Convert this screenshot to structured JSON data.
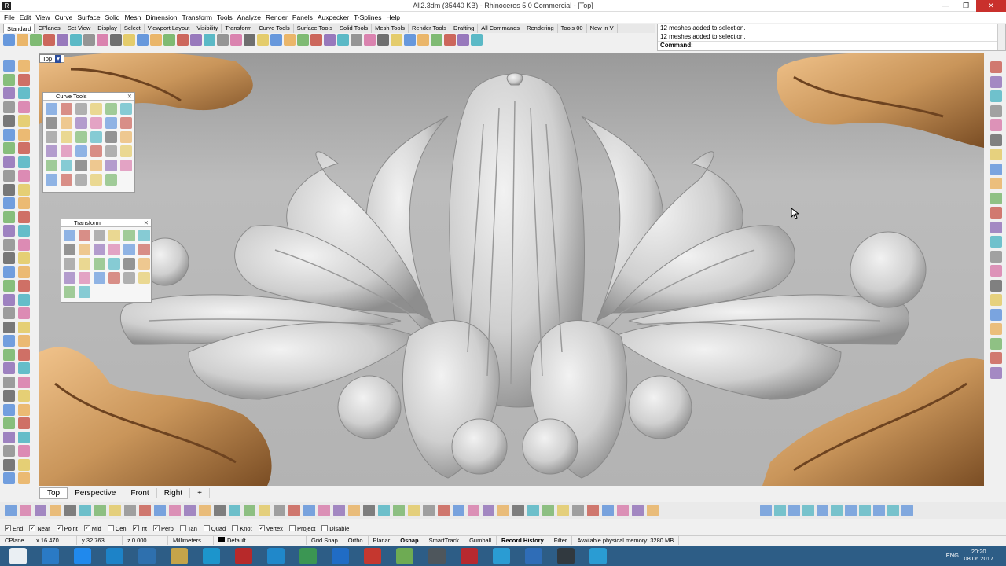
{
  "window": {
    "title": "All2.3dm (35440 KB) - Rhinoceros 5.0 Commercial - [Top]",
    "min_glyph": "—",
    "max_glyph": "❐",
    "close_glyph": "✕",
    "app_icon": "rhino-icon"
  },
  "menu": [
    "File",
    "Edit",
    "View",
    "Curve",
    "Surface",
    "Solid",
    "Mesh",
    "Dimension",
    "Transform",
    "Tools",
    "Analyze",
    "Render",
    "Panels",
    "Auxpecker",
    "T-Splines",
    "Help"
  ],
  "toolbar_tabs": [
    "Standard",
    "CPlanes",
    "Set View",
    "Display",
    "Select",
    "Viewport Layout",
    "Visibility",
    "Transform",
    "Curve Tools",
    "Surface Tools",
    "Solid Tools",
    "Mesh Tools",
    "Render Tools",
    "Drafting",
    "All Commands",
    "Rendering",
    "Tools 00",
    "New in V"
  ],
  "command": {
    "history": [
      "12 meshes added to selection.",
      "12 meshes added to selection."
    ],
    "prompt": "Command:"
  },
  "viewport": {
    "active_label": "Top",
    "arrow_glyph": "▾"
  },
  "panels": {
    "curve_tools": {
      "title": "Curve Tools",
      "close": "✕"
    },
    "transform": {
      "title": "Transform",
      "close": "✕"
    }
  },
  "view_tabs": [
    "Top",
    "Perspective",
    "Front",
    "Right",
    "+"
  ],
  "osnap": {
    "items": [
      {
        "label": "End",
        "checked": true
      },
      {
        "label": "Near",
        "checked": true
      },
      {
        "label": "Point",
        "checked": true
      },
      {
        "label": "Mid",
        "checked": true
      },
      {
        "label": "Cen",
        "checked": false
      },
      {
        "label": "Int",
        "checked": true
      },
      {
        "label": "Perp",
        "checked": true
      },
      {
        "label": "Tan",
        "checked": false
      },
      {
        "label": "Quad",
        "checked": false
      },
      {
        "label": "Knot",
        "checked": false
      },
      {
        "label": "Vertex",
        "checked": true
      },
      {
        "label": "Project",
        "checked": false
      },
      {
        "label": "Disable",
        "checked": false
      }
    ],
    "check_glyph": "✓"
  },
  "status": {
    "cplane": "CPlane",
    "x": "x 16.470",
    "y": "y 32.763",
    "z": "z 0.000",
    "units": "Millimeters",
    "layer": "Default",
    "grid_snap": "Grid Snap",
    "ortho": "Ortho",
    "planar": "Planar",
    "osnap": "Osnap",
    "smarttrack": "SmartTrack",
    "gumball": "Gumball",
    "record_history": "Record History",
    "filter": "Filter",
    "memory": "Available physical memory: 3280 MB"
  },
  "taskbar": {
    "time": "20:20",
    "date": "08.06.2017",
    "lang": "ENG"
  },
  "colors": {
    "accent": "#2a4c9c",
    "ornament_gray": "#d8d8d8",
    "gold": "#c9955a",
    "taskbar": "#2d5d86"
  }
}
